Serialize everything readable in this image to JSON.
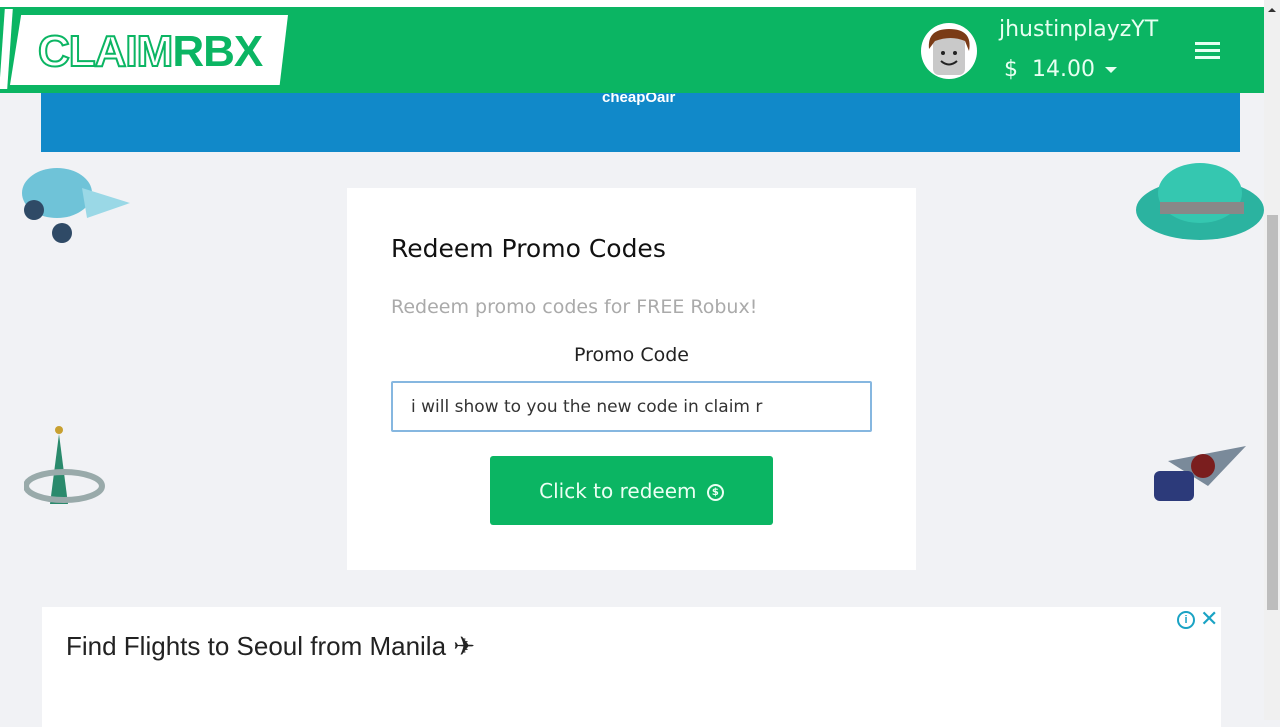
{
  "header": {
    "logo": {
      "part1": "CLAIM",
      "part2": "RBX"
    },
    "username": "jhustinplayzYT",
    "currency_symbol": "$",
    "balance": "14.00",
    "brand_color": "#0bb563"
  },
  "banner": {
    "text": "cheapOair"
  },
  "card": {
    "title": "Redeem Promo Codes",
    "subtitle": "Redeem promo codes for FREE Robux!",
    "field_label": "Promo Code",
    "input_value": "i will show to you the new code in claim r",
    "button_label": "Click to redeem",
    "button_icon": "$"
  },
  "ad": {
    "title": "Find Flights to Seoul from Manila ✈",
    "info": "i",
    "close": "✕"
  }
}
